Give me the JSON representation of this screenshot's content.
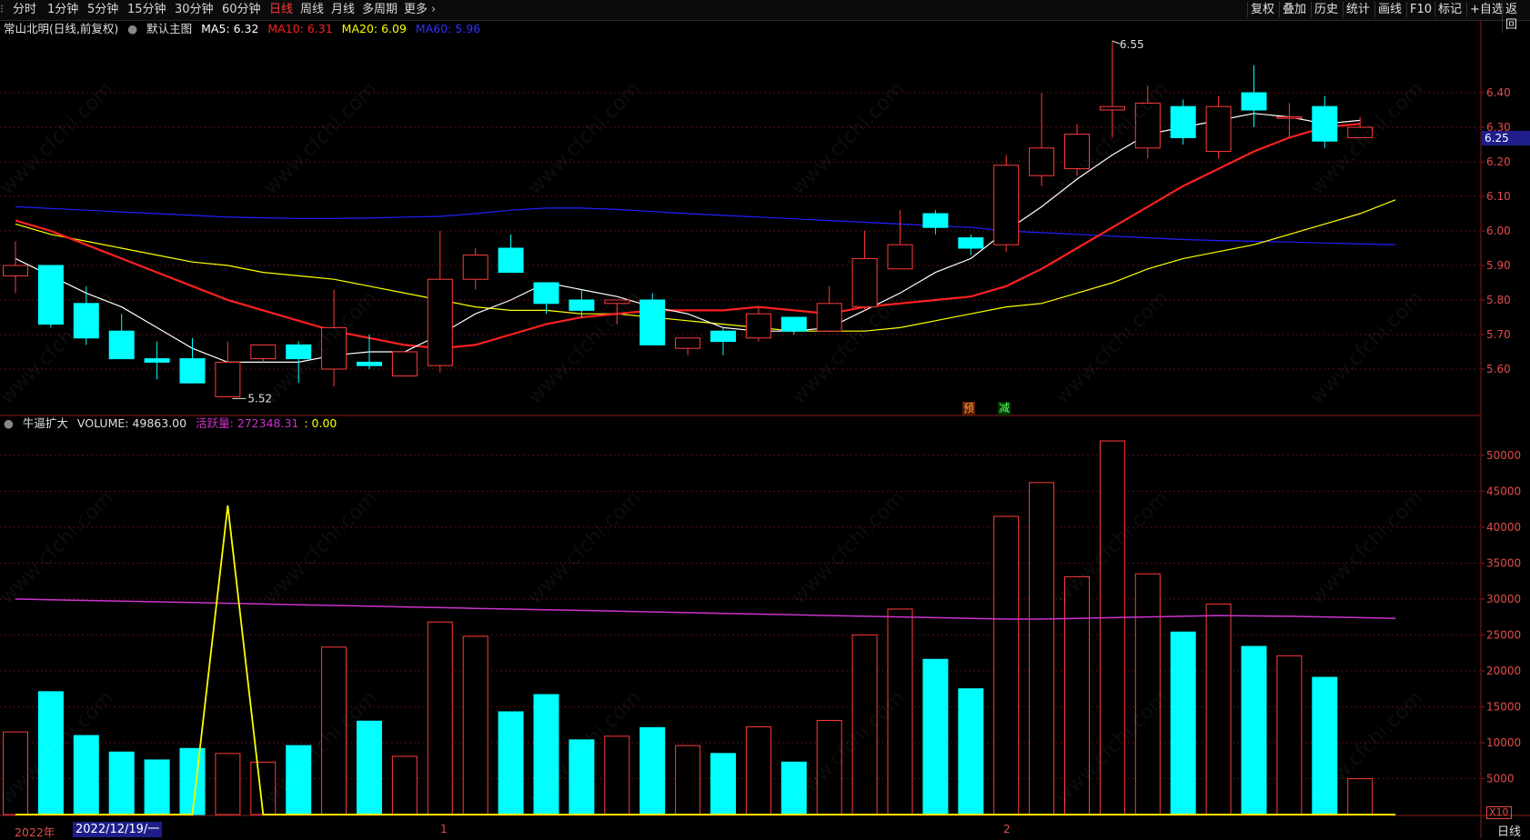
{
  "toolbar": {
    "left_items": [
      {
        "label": "分时",
        "active": false
      },
      {
        "label": "1分钟",
        "active": false
      },
      {
        "label": "5分钟",
        "active": false
      },
      {
        "label": "15分钟",
        "active": false
      },
      {
        "label": "30分钟",
        "active": false
      },
      {
        "label": "60分钟",
        "active": false
      },
      {
        "label": "日线",
        "active": true
      },
      {
        "label": "周线",
        "active": false
      },
      {
        "label": "月线",
        "active": false
      },
      {
        "label": "多周期",
        "active": false
      },
      {
        "label": "更多",
        "active": false
      }
    ],
    "right_items": [
      "复权",
      "叠加",
      "历史",
      "统计",
      "画线",
      "F10",
      "标记",
      "+自选",
      "返回"
    ]
  },
  "price_info": {
    "stock": "常山北明(日线,前复权)",
    "main_chart": "默认主图",
    "ma5": "MA5: 6.32",
    "ma10": "MA10: 6.31",
    "ma20": "MA20: 6.09",
    "ma60": "MA60: 5.96"
  },
  "volume_info": {
    "indicator": "牛逼扩大",
    "volume": "VOLUME: 49863.00",
    "active_label": "活跃量: 272348.31",
    "zero": ": 0.00"
  },
  "price_axis": [
    "6.40",
    "6.30",
    "6.20",
    "6.10",
    "6.00",
    "5.90",
    "5.80",
    "5.70",
    "5.60"
  ],
  "volume_axis": [
    "50000",
    "45000",
    "40000",
    "35000",
    "30000",
    "25000",
    "20000",
    "15000",
    "10000",
    "5000"
  ],
  "current_price": "6.25",
  "annotations": {
    "high": "6.55",
    "low": "5.52",
    "tag1": "预",
    "tag2": "减"
  },
  "bottom": {
    "year": "2022年",
    "date": "2022/12/19/一",
    "month1": "1",
    "month2": "2",
    "period": "日线",
    "x10": "X10"
  },
  "watermark": "www.cfchi.com",
  "colors": {
    "up": "#ff3b3b",
    "down": "#00ffff",
    "ma5": "#ffffff",
    "ma10": "#ff2020",
    "ma20": "#ffff00",
    "ma60": "#2020ff",
    "active_line": "#cc33cc"
  },
  "chart_data": {
    "type": "candlestick",
    "candles": [
      {
        "o": 5.87,
        "h": 5.97,
        "l": 5.82,
        "c": 5.9,
        "v": 11500
      },
      {
        "o": 5.9,
        "h": 5.9,
        "l": 5.72,
        "c": 5.73,
        "v": 17100
      },
      {
        "o": 5.79,
        "h": 5.84,
        "l": 5.67,
        "c": 5.69,
        "v": 11000
      },
      {
        "o": 5.71,
        "h": 5.76,
        "l": 5.63,
        "c": 5.63,
        "v": 8700
      },
      {
        "o": 5.63,
        "h": 5.68,
        "l": 5.57,
        "c": 5.62,
        "v": 7600
      },
      {
        "o": 5.63,
        "h": 5.69,
        "l": 5.56,
        "c": 5.56,
        "v": 9200
      },
      {
        "o": 5.52,
        "h": 5.68,
        "l": 5.52,
        "c": 5.62,
        "v": 8500
      },
      {
        "o": 5.63,
        "h": 5.67,
        "l": 5.62,
        "c": 5.67,
        "v": 7300
      },
      {
        "o": 5.67,
        "h": 5.68,
        "l": 5.56,
        "c": 5.63,
        "v": 9600
      },
      {
        "o": 5.6,
        "h": 5.83,
        "l": 5.55,
        "c": 5.72,
        "v": 23300
      },
      {
        "o": 5.62,
        "h": 5.7,
        "l": 5.6,
        "c": 5.61,
        "v": 13000
      },
      {
        "o": 5.58,
        "h": 5.65,
        "l": 5.58,
        "c": 5.65,
        "v": 8100
      },
      {
        "o": 5.61,
        "h": 6.0,
        "l": 5.59,
        "c": 5.86,
        "v": 26800
      },
      {
        "o": 5.86,
        "h": 5.95,
        "l": 5.83,
        "c": 5.93,
        "v": 24800
      },
      {
        "o": 5.95,
        "h": 5.99,
        "l": 5.88,
        "c": 5.88,
        "v": 14300
      },
      {
        "o": 5.85,
        "h": 5.85,
        "l": 5.76,
        "c": 5.79,
        "v": 16700
      },
      {
        "o": 5.8,
        "h": 5.83,
        "l": 5.75,
        "c": 5.77,
        "v": 10400
      },
      {
        "o": 5.79,
        "h": 5.8,
        "l": 5.73,
        "c": 5.8,
        "v": 10900
      },
      {
        "o": 5.8,
        "h": 5.82,
        "l": 5.67,
        "c": 5.67,
        "v": 12100
      },
      {
        "o": 5.66,
        "h": 5.69,
        "l": 5.64,
        "c": 5.69,
        "v": 9600
      },
      {
        "o": 5.71,
        "h": 5.72,
        "l": 5.64,
        "c": 5.68,
        "v": 8500
      },
      {
        "o": 5.69,
        "h": 5.78,
        "l": 5.68,
        "c": 5.76,
        "v": 12200
      },
      {
        "o": 5.75,
        "h": 5.75,
        "l": 5.7,
        "c": 5.71,
        "v": 7300
      },
      {
        "o": 5.71,
        "h": 5.84,
        "l": 5.71,
        "c": 5.79,
        "v": 13100
      },
      {
        "o": 5.78,
        "h": 6.0,
        "l": 5.77,
        "c": 5.92,
        "v": 25000
      },
      {
        "o": 5.89,
        "h": 6.06,
        "l": 5.89,
        "c": 5.96,
        "v": 28600
      },
      {
        "o": 6.05,
        "h": 6.06,
        "l": 5.99,
        "c": 6.01,
        "v": 21600
      },
      {
        "o": 5.98,
        "h": 5.99,
        "l": 5.93,
        "c": 5.95,
        "v": 17500
      },
      {
        "o": 5.96,
        "h": 6.22,
        "l": 5.94,
        "c": 6.19,
        "v": 41500
      },
      {
        "o": 6.16,
        "h": 6.4,
        "l": 6.13,
        "c": 6.24,
        "v": 46200
      },
      {
        "o": 6.18,
        "h": 6.31,
        "l": 6.16,
        "c": 6.28,
        "v": 33100
      },
      {
        "o": 6.35,
        "h": 6.55,
        "l": 6.27,
        "c": 6.36,
        "v": 52000
      },
      {
        "o": 6.24,
        "h": 6.42,
        "l": 6.21,
        "c": 6.37,
        "v": 33500
      },
      {
        "o": 6.36,
        "h": 6.38,
        "l": 6.25,
        "c": 6.27,
        "v": 25400
      },
      {
        "o": 6.23,
        "h": 6.39,
        "l": 6.21,
        "c": 6.36,
        "v": 29300
      },
      {
        "o": 6.4,
        "h": 6.48,
        "l": 6.3,
        "c": 6.35,
        "v": 23400
      },
      {
        "o": 6.33,
        "h": 6.37,
        "l": 6.27,
        "c": 6.33,
        "v": 22100
      },
      {
        "o": 6.36,
        "h": 6.39,
        "l": 6.24,
        "c": 6.26,
        "v": 19100
      },
      {
        "o": 6.27,
        "h": 6.33,
        "l": 6.27,
        "c": 6.3,
        "v": 4986
      }
    ],
    "ma5": [
      5.92,
      5.87,
      5.82,
      5.78,
      5.72,
      5.66,
      5.62,
      5.62,
      5.62,
      5.64,
      5.65,
      5.65,
      5.7,
      5.76,
      5.8,
      5.85,
      5.83,
      5.81,
      5.78,
      5.76,
      5.72,
      5.71,
      5.71,
      5.72,
      5.77,
      5.82,
      5.88,
      5.92,
      6.0,
      6.07,
      6.15,
      6.22,
      6.28,
      6.3,
      6.32,
      6.34,
      6.33,
      6.31,
      6.32
    ],
    "ma10": [
      6.03,
      6.0,
      5.96,
      5.92,
      5.88,
      5.84,
      5.8,
      5.77,
      5.74,
      5.71,
      5.69,
      5.67,
      5.66,
      5.67,
      5.7,
      5.73,
      5.75,
      5.76,
      5.77,
      5.77,
      5.77,
      5.78,
      5.77,
      5.76,
      5.78,
      5.79,
      5.8,
      5.81,
      5.84,
      5.89,
      5.95,
      6.01,
      6.07,
      6.13,
      6.18,
      6.23,
      6.27,
      6.3,
      6.31
    ],
    "ma20": [
      6.02,
      5.99,
      5.97,
      5.95,
      5.93,
      5.91,
      5.9,
      5.88,
      5.87,
      5.86,
      5.84,
      5.82,
      5.8,
      5.78,
      5.77,
      5.77,
      5.76,
      5.76,
      5.75,
      5.74,
      5.73,
      5.72,
      5.71,
      5.71,
      5.71,
      5.72,
      5.74,
      5.76,
      5.78,
      5.79,
      5.82,
      5.85,
      5.89,
      5.92,
      5.94,
      5.96,
      5.99,
      6.02,
      6.05,
      6.09
    ],
    "ma60": [
      6.07,
      6.065,
      6.06,
      6.055,
      6.05,
      6.045,
      6.04,
      6.038,
      6.036,
      6.036,
      6.037,
      6.04,
      6.042,
      6.05,
      6.06,
      6.066,
      6.066,
      6.062,
      6.056,
      6.05,
      6.045,
      6.04,
      6.035,
      6.03,
      6.025,
      6.02,
      6.015,
      6.01,
      6.0,
      5.995,
      5.99,
      5.985,
      5.98,
      5.975,
      5.972,
      5.97,
      5.968,
      5.965,
      5.962,
      5.96
    ],
    "active_line": [
      30000,
      29900,
      29800,
      29700,
      29600,
      29500,
      29400,
      29300,
      29200,
      29100,
      29000,
      28900,
      28800,
      28700,
      28600,
      28500,
      28400,
      28300,
      28200,
      28100,
      28000,
      27900,
      27800,
      27700,
      27600,
      27500,
      27400,
      27300,
      27200,
      27200,
      27300,
      27400,
      27500,
      27600,
      27700,
      27650,
      27600,
      27500,
      27400,
      27300
    ],
    "signal_line": [
      0,
      0,
      0,
      0,
      0,
      0,
      43000,
      0,
      0,
      0,
      0,
      0,
      0,
      0,
      0,
      0,
      0,
      0,
      0,
      0,
      0,
      0,
      0,
      0,
      0,
      0,
      0,
      0,
      0,
      0,
      0,
      0,
      0,
      0,
      0,
      0,
      0,
      0,
      0,
      0
    ],
    "price_ylim": [
      5.5,
      6.5
    ],
    "volume_ylim": [
      0,
      55000
    ]
  }
}
